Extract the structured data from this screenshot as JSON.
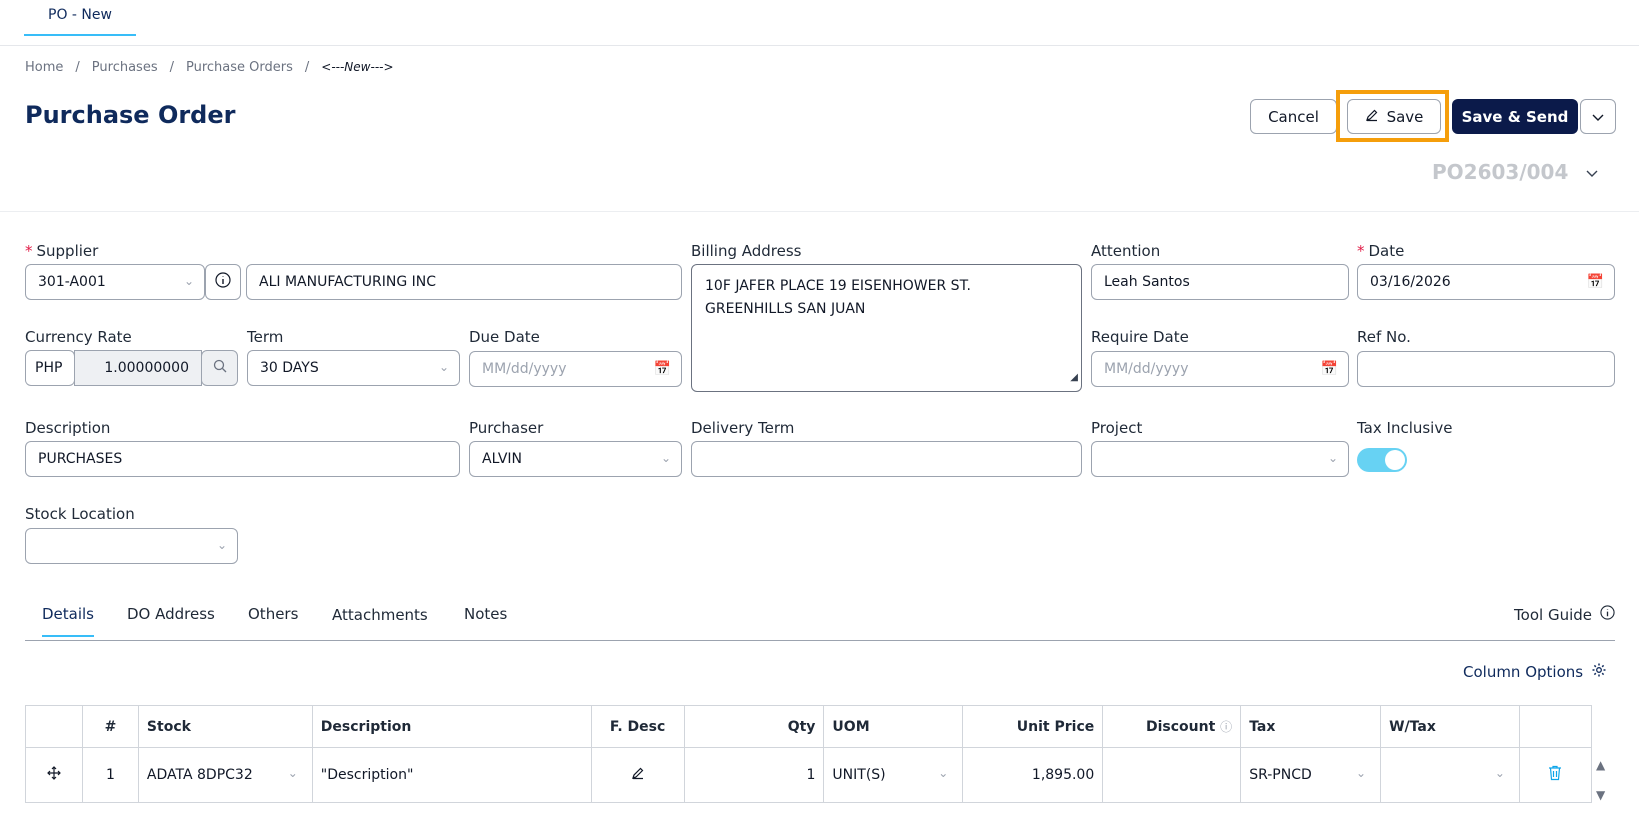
{
  "doc_tab": "PO - New",
  "breadcrumb": [
    "Home",
    "Purchases",
    "Purchase Orders",
    "<---New--->"
  ],
  "title": "Purchase Order",
  "actions": {
    "cancel": "Cancel",
    "save": "Save",
    "save_send": "Save & Send"
  },
  "po_number": "PO2603/004",
  "form": {
    "supplier": {
      "label": "Supplier",
      "code": "301-A001",
      "name": "ALI MANUFACTURING INC"
    },
    "billing_address": {
      "label": "Billing Address",
      "line1": "10F JAFER PLACE 19 EISENHOWER ST.",
      "line2": "GREENHILLS SAN JUAN"
    },
    "attention": {
      "label": "Attention",
      "value": "Leah Santos"
    },
    "date": {
      "label": "Date",
      "value": "03/16/2026"
    },
    "currency_rate": {
      "label": "Currency Rate",
      "currency": "PHP",
      "rate": "1.00000000"
    },
    "term": {
      "label": "Term",
      "value": "30 DAYS"
    },
    "due_date": {
      "label": "Due Date",
      "placeholder": "MM/dd/yyyy"
    },
    "require_date": {
      "label": "Require Date",
      "placeholder": "MM/dd/yyyy"
    },
    "ref_no": {
      "label": "Ref No.",
      "value": ""
    },
    "description": {
      "label": "Description",
      "value": "PURCHASES"
    },
    "purchaser": {
      "label": "Purchaser",
      "value": "ALVIN"
    },
    "delivery_term": {
      "label": "Delivery Term",
      "value": ""
    },
    "project": {
      "label": "Project",
      "value": ""
    },
    "tax_inclusive": {
      "label": "Tax Inclusive",
      "on": true
    },
    "stock_location": {
      "label": "Stock Location",
      "value": ""
    }
  },
  "tabs": [
    "Details",
    "DO Address",
    "Others",
    "Attachments",
    "Notes"
  ],
  "tool_guide": "Tool Guide",
  "column_options": "Column Options",
  "table": {
    "headers": [
      "",
      "#",
      "Stock",
      "Description",
      "F. Desc",
      "Qty",
      "UOM",
      "Unit Price",
      "Discount",
      "Tax",
      "W/Tax",
      ""
    ],
    "rows": [
      {
        "num": "1",
        "stock": "ADATA 8DPC32",
        "description": "\"Description\"",
        "qty": "1",
        "uom": "UNIT(S)",
        "unit_price": "1,895.00",
        "discount": "",
        "tax": "SR-PNCD",
        "wtax": ""
      }
    ]
  },
  "colors": {
    "primary": "#0b1a4a",
    "accent": "#38bdf8",
    "highlight": "#f59e0b",
    "toggle": "#67d2f3"
  }
}
